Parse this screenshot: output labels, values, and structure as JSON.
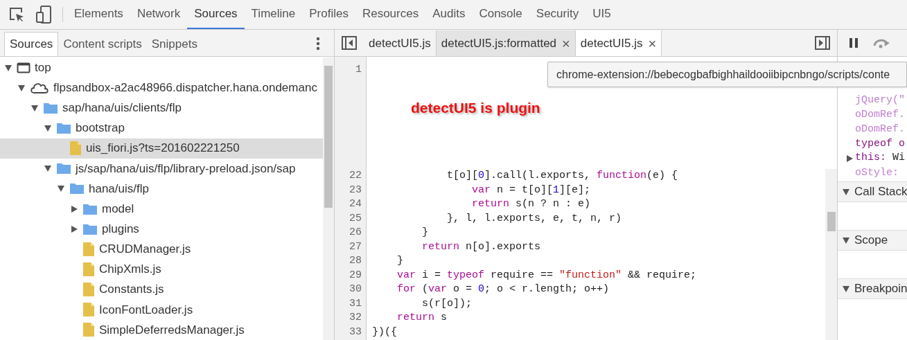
{
  "main_tabs": [
    {
      "label": "Elements",
      "selected": false
    },
    {
      "label": "Network",
      "selected": false
    },
    {
      "label": "Sources",
      "selected": true
    },
    {
      "label": "Timeline",
      "selected": false
    },
    {
      "label": "Profiles",
      "selected": false
    },
    {
      "label": "Resources",
      "selected": false
    },
    {
      "label": "Audits",
      "selected": false
    },
    {
      "label": "Console",
      "selected": false
    },
    {
      "label": "Security",
      "selected": false
    },
    {
      "label": "UI5",
      "selected": false
    }
  ],
  "navigator_tabs": [
    {
      "label": "Sources",
      "selected": true
    },
    {
      "label": "Content scripts",
      "selected": false
    },
    {
      "label": "Snippets",
      "selected": false
    }
  ],
  "tree": [
    {
      "kind": "frame",
      "label": "top",
      "expanded": true,
      "selected": false,
      "children": [
        {
          "kind": "domain",
          "label": "flpsandbox-a2ac48966.dispatcher.hana.ondemanc",
          "expanded": true,
          "selected": false,
          "children": [
            {
              "kind": "folder",
              "label": "sap/hana/uis/clients/flp",
              "expanded": true,
              "selected": false,
              "children": [
                {
                  "kind": "folder",
                  "label": "bootstrap",
                  "expanded": true,
                  "selected": false,
                  "children": [
                    {
                      "kind": "file",
                      "label": "uis_fiori.js?ts=201602221250",
                      "selected": true
                    }
                  ]
                },
                {
                  "kind": "folder",
                  "label": "js/sap/hana/uis/flp/library-preload.json/sap",
                  "expanded": true,
                  "selected": false,
                  "children": [
                    {
                      "kind": "folder",
                      "label": "hana/uis/flp",
                      "expanded": true,
                      "selected": false,
                      "children": [
                        {
                          "kind": "folder",
                          "label": "model",
                          "expanded": false,
                          "selected": false
                        },
                        {
                          "kind": "folder",
                          "label": "plugins",
                          "expanded": false,
                          "selected": false
                        },
                        {
                          "kind": "file",
                          "label": "CRUDManager.js",
                          "selected": false
                        },
                        {
                          "kind": "file",
                          "label": "ChipXmls.js",
                          "selected": false
                        },
                        {
                          "kind": "file",
                          "label": "Constants.js",
                          "selected": false
                        },
                        {
                          "kind": "file",
                          "label": "IconFontLoader.js",
                          "selected": false
                        },
                        {
                          "kind": "file",
                          "label": "SimpleDeferredsManager.js",
                          "selected": false
                        }
                      ]
                    }
                  ]
                }
              ]
            }
          ]
        }
      ]
    }
  ],
  "editor_tabs": [
    {
      "label": "detectUI5.js",
      "selected": false,
      "closable": false
    },
    {
      "label": "detectUI5.js:formatted",
      "selected": false,
      "closable": true
    },
    {
      "label": "detectUI5.js",
      "selected": true,
      "closable": true
    }
  ],
  "close_glyph": "×",
  "first_line": "1",
  "tooltip": "chrome-extension://bebecogbafbighhaildooiibipcnbngo/scripts/conte",
  "annotation": "detectUI5 is plugin",
  "code_lines": [
    {
      "number": "22",
      "tokens": [
        {
          "kind": "plain",
          "text": "            t[o]["
        },
        {
          "kind": "number",
          "text": "0"
        },
        {
          "kind": "plain",
          "text": "].call(l.exports, "
        },
        {
          "kind": "keyword",
          "text": "function"
        },
        {
          "kind": "plain",
          "text": "(e) {"
        }
      ]
    },
    {
      "number": "23",
      "tokens": [
        {
          "kind": "keyword",
          "text": "                var"
        },
        {
          "kind": "plain",
          "text": " n = t[o]["
        },
        {
          "kind": "number",
          "text": "1"
        },
        {
          "kind": "plain",
          "text": "][e];"
        }
      ]
    },
    {
      "number": "24",
      "tokens": [
        {
          "kind": "keyword",
          "text": "                return"
        },
        {
          "kind": "plain",
          "text": " s(n ? n : e)"
        }
      ]
    },
    {
      "number": "25",
      "tokens": [
        {
          "kind": "plain",
          "text": "            }, l, l.exports, e, t, n, r)"
        }
      ]
    },
    {
      "number": "26",
      "tokens": [
        {
          "kind": "plain",
          "text": "        }"
        }
      ]
    },
    {
      "number": "27",
      "tokens": [
        {
          "kind": "keyword",
          "text": "        return"
        },
        {
          "kind": "plain",
          "text": " n[o].exports"
        }
      ]
    },
    {
      "number": "28",
      "tokens": [
        {
          "kind": "plain",
          "text": "    }"
        }
      ]
    },
    {
      "number": "29",
      "tokens": [
        {
          "kind": "keyword",
          "text": "    var"
        },
        {
          "kind": "plain",
          "text": " i = "
        },
        {
          "kind": "keyword",
          "text": "typeof"
        },
        {
          "kind": "plain",
          "text": " require == "
        },
        {
          "kind": "string",
          "text": "\"function\""
        },
        {
          "kind": "plain",
          "text": " && require;"
        }
      ]
    },
    {
      "number": "30",
      "tokens": [
        {
          "kind": "keyword",
          "text": "    for"
        },
        {
          "kind": "plain",
          "text": " ("
        },
        {
          "kind": "keyword",
          "text": "var"
        },
        {
          "kind": "plain",
          "text": " o = "
        },
        {
          "kind": "number",
          "text": "0"
        },
        {
          "kind": "plain",
          "text": "; o < r.length; o++)"
        }
      ]
    },
    {
      "number": "31",
      "tokens": [
        {
          "kind": "plain",
          "text": "        s(r[o]);"
        }
      ]
    },
    {
      "number": "32",
      "tokens": [
        {
          "kind": "keyword",
          "text": "    return"
        },
        {
          "kind": "plain",
          "text": " s"
        }
      ]
    },
    {
      "number": "33",
      "tokens": [
        {
          "kind": "plain",
          "text": "})({"
        }
      ]
    }
  ],
  "watch": [
    {
      "kind": "value",
      "text": "jQuery(\""
    },
    {
      "kind": "value",
      "text": "oDomRef."
    },
    {
      "kind": "value",
      "text": "oDomRef."
    },
    {
      "kind": "keyword",
      "text": "typeof o"
    },
    {
      "kind": "object",
      "key": "this:",
      "text": "Wi",
      "expanded": false
    },
    {
      "kind": "value",
      "text": "oStyle:"
    }
  ],
  "sections": [
    {
      "label": "Call Stack",
      "expanded": true
    },
    {
      "label": "Scope",
      "expanded": true
    },
    {
      "label": "Breakpoin",
      "expanded": true
    }
  ]
}
